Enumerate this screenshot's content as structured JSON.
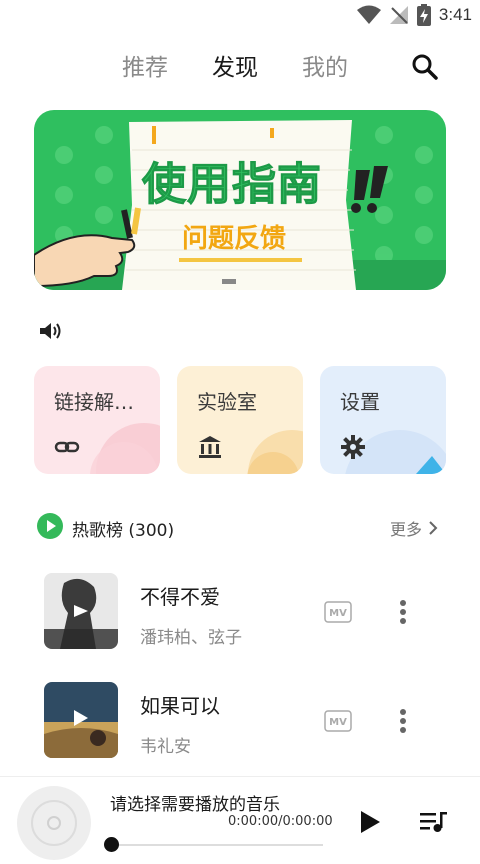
{
  "status_bar": {
    "time": "3:41"
  },
  "nav": {
    "tabs": [
      "推荐",
      "发现",
      "我的"
    ],
    "active_tab": "发现"
  },
  "banner": {
    "title": "使用指南",
    "subtitle": "问题反馈",
    "accent": "#2fbf5f"
  },
  "quick_cards": [
    {
      "label": "链接解…",
      "icon": "link-icon"
    },
    {
      "label": "实验室",
      "icon": "bank-icon"
    },
    {
      "label": "设置",
      "icon": "gear-icon"
    }
  ],
  "hot_list": {
    "title": "热歌榜 (300)",
    "more_label": "更多"
  },
  "songs": [
    {
      "title": "不得不爱",
      "artist": "潘玮柏、弦子",
      "badge": "MV"
    },
    {
      "title": "如果可以",
      "artist": "韦礼安",
      "badge": "MV"
    }
  ],
  "player": {
    "prompt": "请选择需要播放的音乐",
    "time": "0:00:00/0:00:00",
    "progress": 0
  }
}
